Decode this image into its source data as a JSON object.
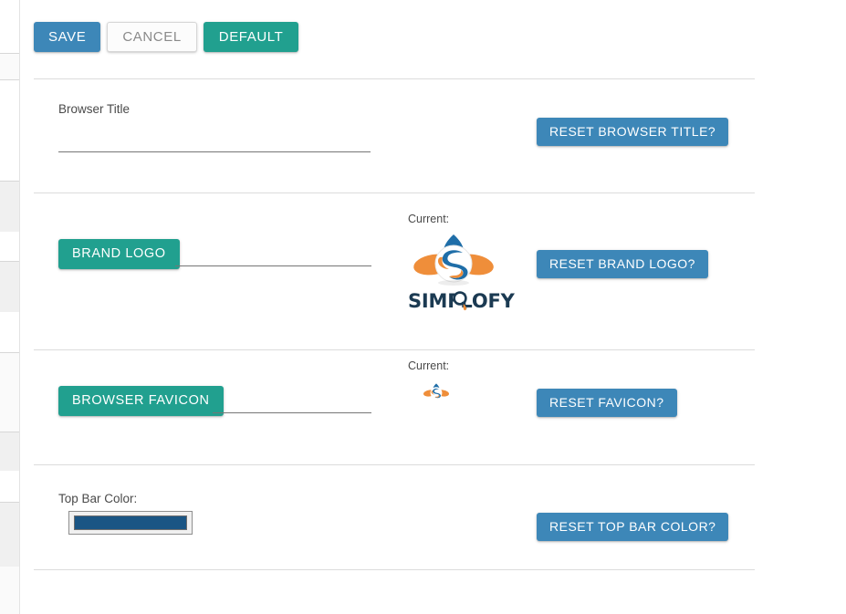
{
  "toolbar": {
    "save_label": "SAVE",
    "cancel_label": "CANCEL",
    "default_label": "DEFAULT"
  },
  "colors": {
    "primary_blue": "#3d87b8",
    "teal": "#21a08f",
    "top_bar_color_value": "#1a5584",
    "divider": "#dcdcdc",
    "logo_blue": "#1f6ea8",
    "logo_dark_blue": "#1b3a52",
    "logo_orange": "#ef8e3a"
  },
  "rows": {
    "browser_title": {
      "label": "Browser Title",
      "input_value": "",
      "input_placeholder": "",
      "reset_label": "RESET BROWSER TITLE?"
    },
    "brand_logo": {
      "upload_label": "BRAND LOGO",
      "file_value": "",
      "current_label": "Current:",
      "logo_wordmark": "SIMFLOFY",
      "reset_label": "RESET BRAND LOGO?"
    },
    "browser_favicon": {
      "upload_label": "BROWSER FAVICON",
      "file_value": "",
      "current_label": "Current:",
      "reset_label": "RESET FAVICON?"
    },
    "top_bar_color": {
      "label": "Top Bar Color:",
      "value": "#1a5584",
      "reset_label": "RESET TOP BAR COLOR?"
    }
  }
}
